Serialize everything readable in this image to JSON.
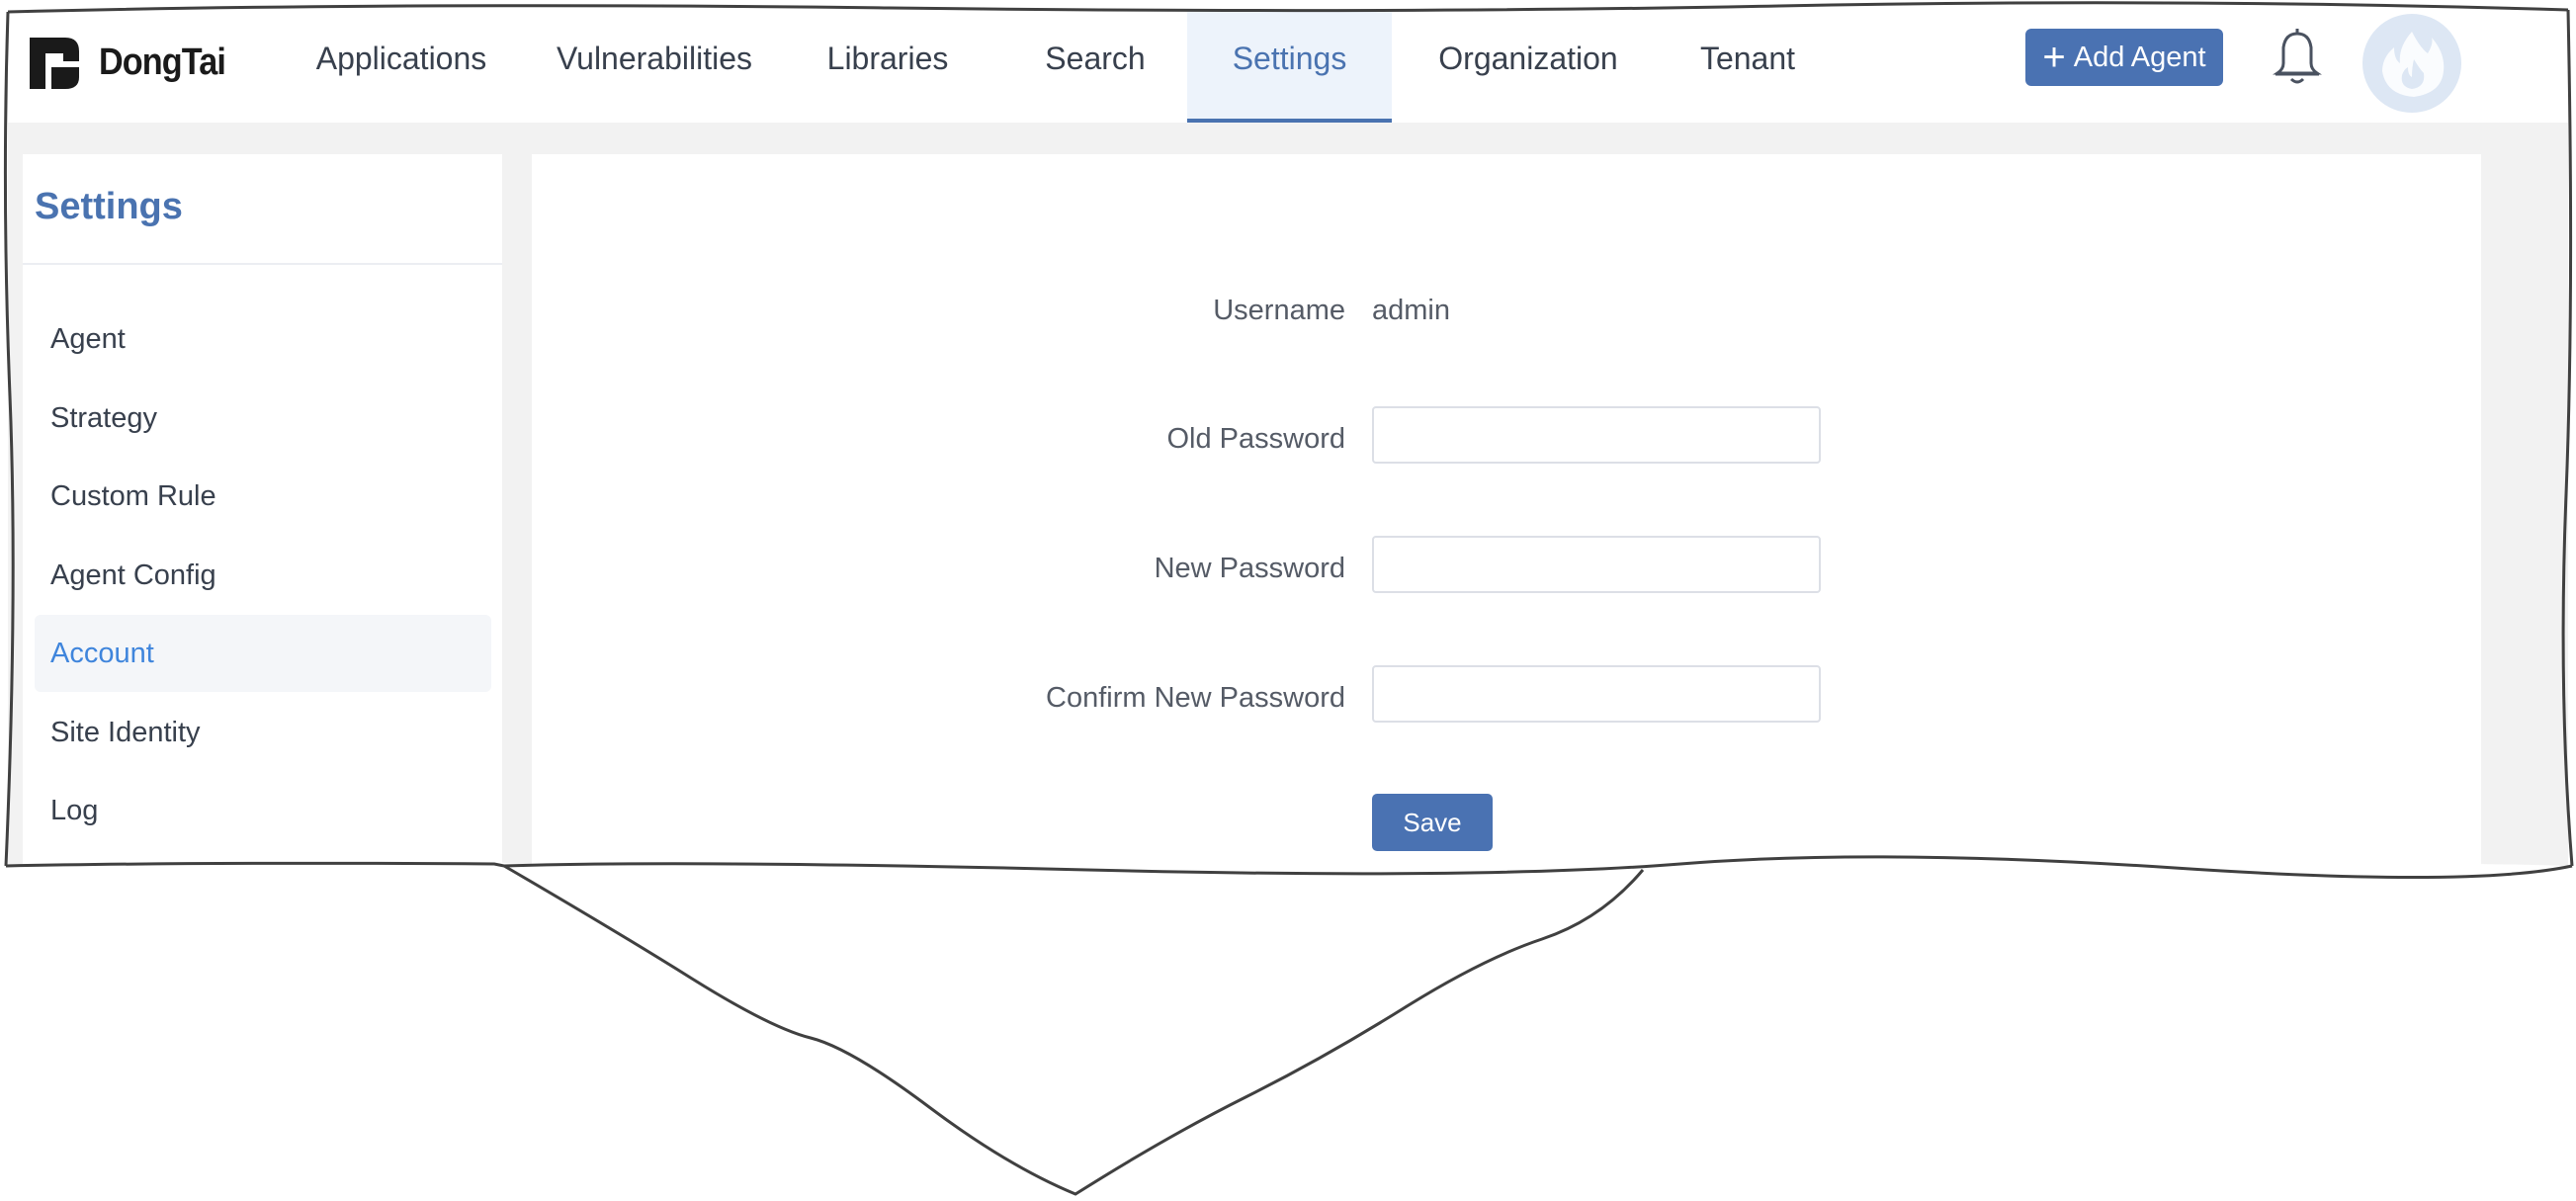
{
  "brand": {
    "name": "DongTai"
  },
  "nav": {
    "items": [
      {
        "label": "Applications"
      },
      {
        "label": "Vulnerabilities"
      },
      {
        "label": "Libraries"
      },
      {
        "label": "Search"
      },
      {
        "label": "Settings",
        "active": true
      },
      {
        "label": "Organization"
      },
      {
        "label": "Tenant"
      }
    ],
    "add_agent_label": "Add Agent",
    "icons": {
      "add": "plus-icon",
      "notifications": "bell-icon",
      "avatar": "flame-icon"
    }
  },
  "sidebar": {
    "title": "Settings",
    "items": [
      {
        "label": "Agent"
      },
      {
        "label": "Strategy"
      },
      {
        "label": "Custom Rule"
      },
      {
        "label": "Agent Config"
      },
      {
        "label": "Account",
        "active": true
      },
      {
        "label": "Site Identity"
      },
      {
        "label": "Log"
      }
    ]
  },
  "account_form": {
    "username_label": "Username",
    "username_value": "admin",
    "old_password_label": "Old Password",
    "old_password_value": "",
    "new_password_label": "New Password",
    "new_password_value": "",
    "confirm_password_label": "Confirm New Password",
    "confirm_password_value": "",
    "save_label": "Save"
  },
  "colors": {
    "accent": "#4a72b2",
    "active_nav_bg": "#edf3fb",
    "active_sidebar_text": "#3f85dc",
    "page_bg": "#f2f2f2"
  }
}
